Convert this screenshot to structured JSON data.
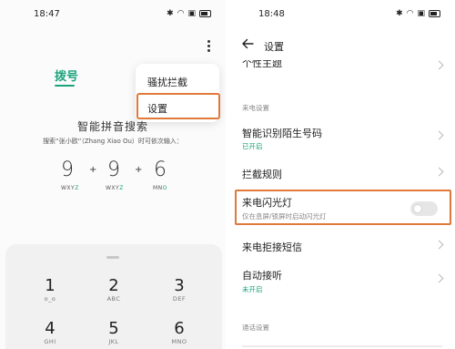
{
  "left_screen": {
    "status_time": "18:47",
    "tab_dial": "拨号",
    "popup_menu": {
      "items": [
        "骚扰拦截",
        "设置"
      ],
      "highlighted": "设置"
    },
    "pinyin_title": "智能拼音搜索",
    "pinyin_hint": "搜索“张小欧”（Zhang Xiao Ou）时可依次输入：",
    "example": [
      {
        "digit": "9",
        "letters_plain": "WXY",
        "letters_hl": "Z"
      },
      {
        "digit": "9",
        "letters_plain": "WXY",
        "letters_hl": "Z"
      },
      {
        "digit": "6",
        "letters_plain": "MN",
        "letters_hl": "O"
      }
    ],
    "keypad": [
      {
        "digit": "1",
        "letters": "ᢁᢁ"
      },
      {
        "digit": "2",
        "letters": "ABC"
      },
      {
        "digit": "3",
        "letters": "DEF"
      },
      {
        "digit": "4",
        "letters": "GHI"
      },
      {
        "digit": "5",
        "letters": "JKL"
      },
      {
        "digit": "6",
        "letters": "MNO"
      }
    ]
  },
  "right_screen": {
    "status_time": "18:48",
    "title": "设置",
    "rows": {
      "theme": "个性主题",
      "section_call": "来电设置",
      "smart_id": "智能识别陌生号码",
      "smart_id_status": "已开启",
      "block_rules": "拦截规则",
      "flash": "来电闪光灯",
      "flash_desc": "仅在息屏/锁屏时启动闪光灯",
      "flash_enabled": false,
      "reject_sms": "来电拒接短信",
      "auto_answer": "自动接听",
      "auto_answer_status": "未开启",
      "section_dial": "通话设置"
    }
  },
  "colors": {
    "accent": "#1aa37c",
    "highlight_box": "#e0793a"
  }
}
